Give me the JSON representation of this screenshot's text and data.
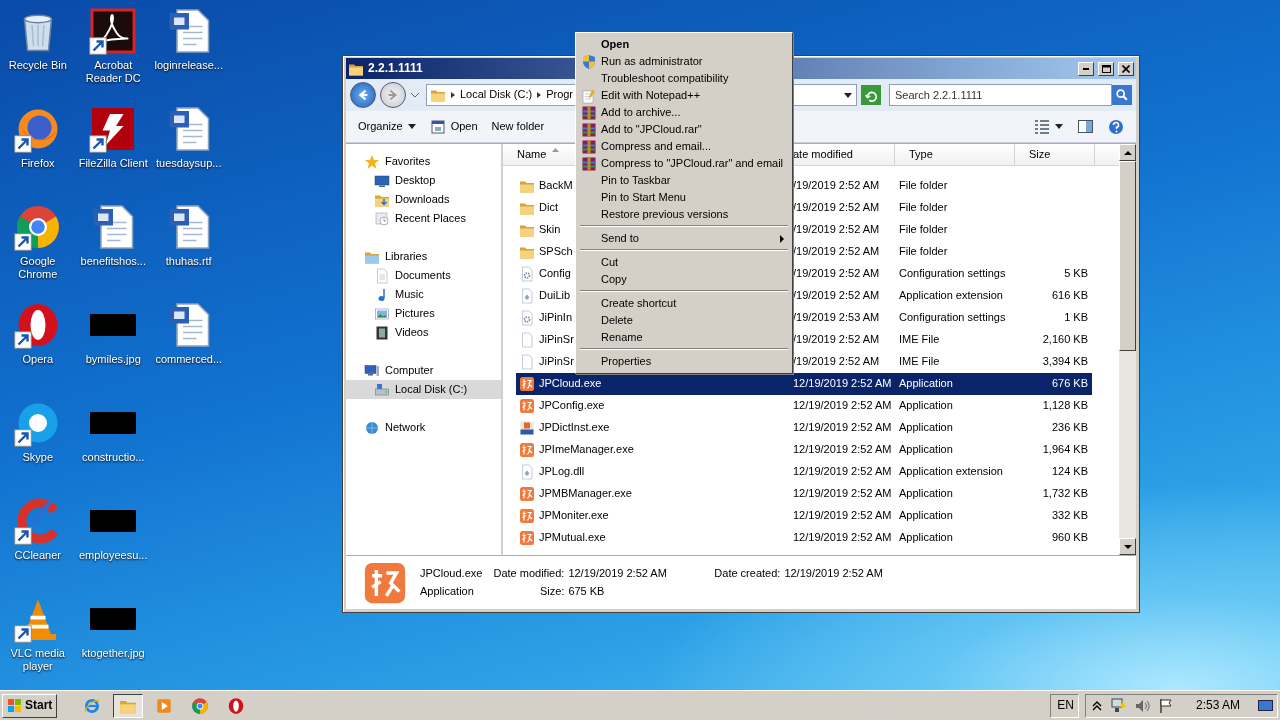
{
  "desktop_icons": [
    {
      "label": "Recycle Bin",
      "kind": "recycle",
      "shortcut": false
    },
    {
      "label": "Firefox",
      "kind": "firefox",
      "shortcut": true
    },
    {
      "label": "Google Chrome",
      "kind": "chrome",
      "shortcut": true
    },
    {
      "label": "Opera",
      "kind": "opera",
      "shortcut": true
    },
    {
      "label": "Skype",
      "kind": "skype",
      "shortcut": true
    },
    {
      "label": "CCleaner",
      "kind": "ccleaner",
      "shortcut": true
    },
    {
      "label": "VLC media player",
      "kind": "vlc",
      "shortcut": true
    },
    {
      "label": "Acrobat Reader DC",
      "kind": "acrobat",
      "shortcut": true
    },
    {
      "label": "FileZilla Client",
      "kind": "filezilla",
      "shortcut": true
    },
    {
      "label": "benefitshos...",
      "kind": "word",
      "shortcut": false
    },
    {
      "label": "bymiles.jpg",
      "kind": "redacted",
      "shortcut": false
    },
    {
      "label": "constructio...",
      "kind": "redacted",
      "shortcut": false
    },
    {
      "label": "employeesu...",
      "kind": "redacted",
      "shortcut": false
    },
    {
      "label": "ktogether.jpg",
      "kind": "redacted",
      "shortcut": false
    },
    {
      "label": "loginrelease...",
      "kind": "word",
      "shortcut": false
    },
    {
      "label": "tuesdaysup...",
      "kind": "word",
      "shortcut": false
    },
    {
      "label": "thuhas.rtf",
      "kind": "word",
      "shortcut": false
    },
    {
      "label": "commerced...",
      "kind": "word",
      "shortcut": false
    }
  ],
  "explorer": {
    "title": "2.2.1.1111",
    "address": [
      "Local Disk (C:)",
      "Progr"
    ],
    "search": {
      "placeholder": "Search 2.2.1.1111"
    },
    "toolbar": [
      {
        "label": "Organize",
        "kind": "menu"
      },
      {
        "label": "Open",
        "kind": "icon"
      },
      {
        "label": "New folder",
        "kind": "plain"
      }
    ],
    "nav": [
      {
        "label": "Favorites",
        "kind": "star",
        "selected": false,
        "children": [
          {
            "label": "Desktop",
            "kind": "desktop",
            "selected": false
          },
          {
            "label": "Downloads",
            "kind": "downloads",
            "selected": false
          },
          {
            "label": "Recent Places",
            "kind": "recent",
            "selected": false
          }
        ]
      },
      {
        "label": "Libraries",
        "kind": "libraries",
        "selected": false,
        "children": [
          {
            "label": "Documents",
            "kind": "documents",
            "selected": false
          },
          {
            "label": "Music",
            "kind": "music",
            "selected": false
          },
          {
            "label": "Pictures",
            "kind": "pictures",
            "selected": false
          },
          {
            "label": "Videos",
            "kind": "videos",
            "selected": false
          }
        ]
      },
      {
        "label": "Computer",
        "kind": "computer",
        "selected": false,
        "children": [
          {
            "label": "Local Disk (C:)",
            "kind": "disk",
            "selected": true
          }
        ]
      },
      {
        "label": "Network",
        "kind": "network",
        "selected": false
      }
    ],
    "columns": [
      {
        "label": "Name",
        "sorted": true
      },
      {
        "label": "ate modified",
        "sorted": false
      },
      {
        "label": "Type",
        "sorted": false
      },
      {
        "label": "Size",
        "sorted": false
      }
    ],
    "rows": [
      {
        "name": "BackM",
        "kind": "folder",
        "date": "/19/2019 2:52 AM",
        "type": "File folder",
        "selected": false
      },
      {
        "name": "Dict",
        "kind": "folder",
        "date": "/19/2019 2:52 AM",
        "type": "File folder",
        "selected": false
      },
      {
        "name": "Skin",
        "kind": "folder",
        "date": "/19/2019 2:52 AM",
        "type": "File folder",
        "selected": false
      },
      {
        "name": "SPSch",
        "kind": "folder",
        "date": "/19/2019 2:52 AM",
        "type": "File folder",
        "selected": false
      },
      {
        "name": "Config",
        "kind": "config",
        "date": "/19/2019 2:52 AM",
        "type": "Configuration settings",
        "size": "5 KB",
        "selected": false
      },
      {
        "name": "DuiLib",
        "kind": "dll",
        "date": "/19/2019 2:52 AM",
        "type": "Application extension",
        "size": "616 KB",
        "selected": false
      },
      {
        "name": "JiPinIn",
        "kind": "config",
        "date": "/19/2019 2:53 AM",
        "type": "Configuration settings",
        "size": "1 KB",
        "selected": false
      },
      {
        "name": "JiPinSr",
        "kind": "blank",
        "date": "/19/2019 2:52 AM",
        "type": "IME File",
        "size": "2,160 KB",
        "selected": false
      },
      {
        "name": "JiPinSr",
        "kind": "blank",
        "date": "/19/2019 2:52 AM",
        "type": "IME File",
        "size": "3,394 KB",
        "selected": false
      },
      {
        "name": "JPCloud.exe",
        "kind": "app",
        "date": "12/19/2019 2:52 AM",
        "type": "Application",
        "size": "676 KB",
        "selected": true
      },
      {
        "name": "JPConfig.exe",
        "kind": "app",
        "date": "12/19/2019 2:52 AM",
        "type": "Application",
        "size": "1,128 KB",
        "selected": false
      },
      {
        "name": "JPDictInst.exe",
        "kind": "dict",
        "date": "12/19/2019 2:52 AM",
        "type": "Application",
        "size": "236 KB",
        "selected": false
      },
      {
        "name": "JPImeManager.exe",
        "kind": "app",
        "date": "12/19/2019 2:52 AM",
        "type": "Application",
        "size": "1,964 KB",
        "selected": false
      },
      {
        "name": "JPLog.dll",
        "kind": "dll",
        "date": "12/19/2019 2:52 AM",
        "type": "Application extension",
        "size": "124 KB",
        "selected": false
      },
      {
        "name": "JPMBManager.exe",
        "kind": "app",
        "date": "12/19/2019 2:52 AM",
        "type": "Application",
        "size": "1,732 KB",
        "selected": false
      },
      {
        "name": "JPMoniter.exe",
        "kind": "app",
        "date": "12/19/2019 2:52 AM",
        "type": "Application",
        "size": "332 KB",
        "selected": false
      },
      {
        "name": "JPMutual.exe",
        "kind": "app",
        "date": "12/19/2019 2:52 AM",
        "type": "Application",
        "size": "960 KB",
        "selected": false
      }
    ],
    "details": {
      "name": "JPCloud.exe",
      "type": "Application",
      "fields": [
        {
          "label": "Date modified:",
          "value": "12/19/2019 2:52 AM"
        },
        {
          "label": "Date created:",
          "value": "12/19/2019 2:52 AM"
        },
        {
          "label": "Size:",
          "value": "675 KB"
        }
      ]
    }
  },
  "context_menu": [
    {
      "kind": "plain",
      "label": "Open",
      "default": true,
      "submenu": false
    },
    {
      "kind": "shield",
      "label": "Run as administrator",
      "default": false,
      "submenu": false
    },
    {
      "kind": "plain",
      "label": "Troubleshoot compatibility",
      "default": false,
      "submenu": false
    },
    {
      "kind": "notepad",
      "label": "Edit with Notepad++",
      "default": false,
      "submenu": false
    },
    {
      "kind": "archive",
      "label": "Add to archive...",
      "default": false,
      "submenu": false
    },
    {
      "kind": "archive",
      "label": "Add to \"JPCloud.rar\"",
      "default": false,
      "submenu": false
    },
    {
      "kind": "archive",
      "label": "Compress and email...",
      "default": false,
      "submenu": false
    },
    {
      "kind": "archive",
      "label": "Compress to \"JPCloud.rar\" and email",
      "default": false,
      "submenu": false
    },
    {
      "kind": "plain",
      "label": "Pin to Taskbar",
      "default": false,
      "submenu": false
    },
    {
      "kind": "plain",
      "label": "Pin to Start Menu",
      "default": false,
      "submenu": false
    },
    {
      "kind": "plain",
      "label": "Restore previous versions",
      "default": false,
      "submenu": false
    },
    {
      "kind": "separator"
    },
    {
      "kind": "plain",
      "label": "Send to",
      "default": false,
      "submenu": true
    },
    {
      "kind": "separator"
    },
    {
      "kind": "plain",
      "label": "Cut",
      "default": false,
      "submenu": false
    },
    {
      "kind": "plain",
      "label": "Copy",
      "default": false,
      "submenu": false
    },
    {
      "kind": "separator"
    },
    {
      "kind": "plain",
      "label": "Create shortcut",
      "default": false,
      "submenu": false
    },
    {
      "kind": "plain",
      "label": "Delete",
      "default": false,
      "submenu": false
    },
    {
      "kind": "plain",
      "label": "Rename",
      "default": false,
      "submenu": false
    },
    {
      "kind": "separator"
    },
    {
      "kind": "plain",
      "label": "Properties",
      "default": false,
      "submenu": false
    }
  ],
  "taskbar": {
    "start": "Start",
    "apps": [
      {
        "kind": "ie",
        "active": false
      },
      {
        "kind": "explorer",
        "active": true
      },
      {
        "kind": "media",
        "active": false
      },
      {
        "kind": "chrome",
        "active": false
      },
      {
        "kind": "opera",
        "active": false
      }
    ],
    "language": "EN",
    "clock": "2:53 AM"
  }
}
